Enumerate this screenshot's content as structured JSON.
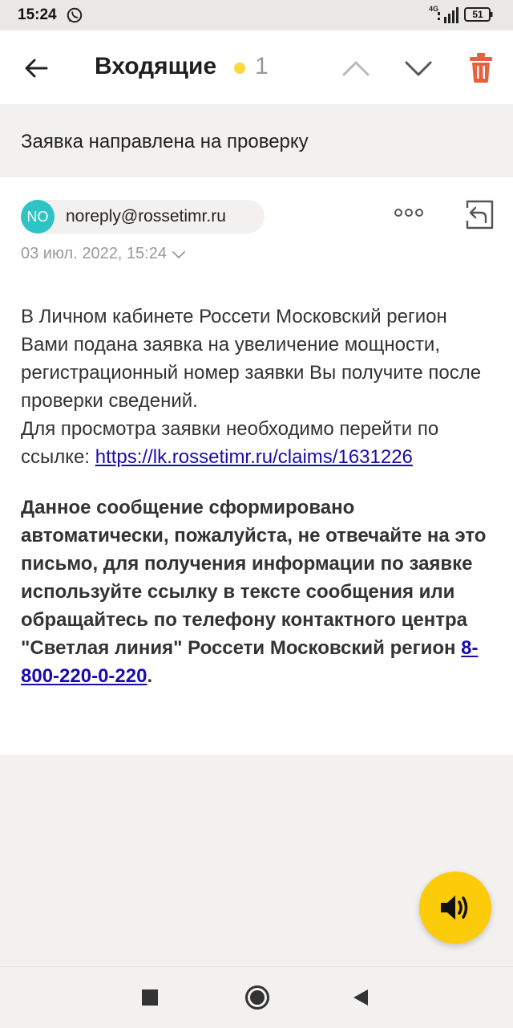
{
  "status_bar": {
    "time": "15:24",
    "network": "4G",
    "battery": "51",
    "icons": [
      "whatsapp-icon",
      "signal-icon",
      "battery-icon"
    ]
  },
  "header": {
    "title": "Входящие",
    "unread_count": "1",
    "colors": {
      "unread_dot": "#fcd83d",
      "trash": "#e8613f"
    },
    "icons": [
      "back-arrow-icon",
      "chevron-up-icon",
      "chevron-down-icon",
      "trash-icon"
    ]
  },
  "subject": "Заявка направлена на проверку",
  "message": {
    "avatar_initials": "NO",
    "avatar_color": "#2fc4c4",
    "sender_email": "noreply@rossetimr.ru",
    "date": "03 июл. 2022, 15:24",
    "body_intro": "В Личном кабинете Россети Московский регион Вами подана заявка на увеличение мощности, регистрационный номер заявки Вы получите после проверки сведений.",
    "body_link_prefix": "Для просмотра заявки необходимо перейти по ссылке: ",
    "body_link": "https://lk.rossetimr.ru/claims/1631226",
    "notice_text": "Данное сообщение сформировано автоматически, пожалуйста, не отвечайте на это письмо, для получения информации по заявке используйте ссылку в тексте сообщения или обращайтесь по телефону контактного центра \"Светлая линия\" Россети Московский регион ",
    "notice_phone": "8-800-220-0-220",
    "notice_end": ".",
    "icons": [
      "more-dots-icon",
      "reply-icon",
      "chevron-down-icon"
    ]
  },
  "fab": {
    "icon": "speaker-icon",
    "color": "#fccb0a"
  },
  "nav_bar": {
    "icons": [
      "recents-square-icon",
      "home-circle-icon",
      "back-triangle-icon"
    ]
  }
}
